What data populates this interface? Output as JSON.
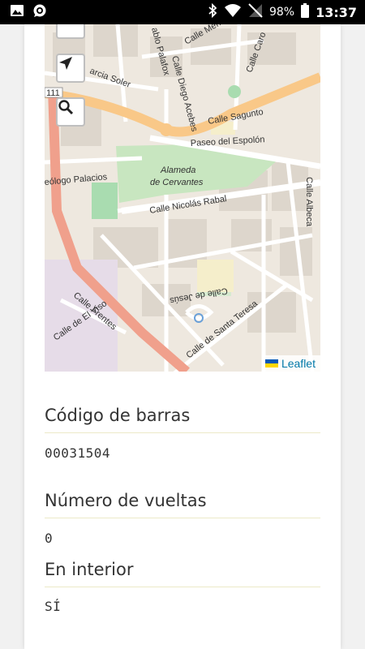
{
  "status_bar": {
    "battery_percent": "98%",
    "time": "13:37",
    "icons": [
      "image-icon",
      "whatsapp-icon",
      "bluetooth-icon",
      "wifi-icon",
      "no-signal-icon",
      "battery-icon"
    ]
  },
  "map": {
    "attribution": "Leaflet",
    "route_number": "111",
    "labels": {
      "calle_sagunto": "Calle Sagunto",
      "paseo_espolon": "Paseo del Espolón",
      "alameda": "Alameda",
      "cervantes": "de Cervantes",
      "calle_nicolas_rabal": "Calle Nicolás Rabal",
      "calle_albeca": "Calle Albeca",
      "geologo_palacios": "eólogo Palacios",
      "garcia_soler": "arcia Soler",
      "calle_diego_acebes": "Calle Diego Acebes",
      "pablo_palafox": "ablo Palafox",
      "calle_merino": "Calle Meri",
      "calle_caro": "Calle Caro",
      "calle_frentes": "Calle Frentes",
      "calle_el_viso": "Calle de El Viso",
      "calle_santa_teresa": "Calle de Santa Teresa",
      "calle_jesus": "Calle de Jesús"
    },
    "colors": {
      "background": "#eee8df",
      "park": "#c8e6c0",
      "major_road": "#f9c888",
      "primary_road": "#f0a08c",
      "minor_road": "#ffffff",
      "leaflet_link": "#0078a8"
    }
  },
  "fields": [
    {
      "label": "Código de barras",
      "value": "00031504"
    },
    {
      "label": "Número de vueltas",
      "value": "0"
    },
    {
      "label": "En interior",
      "value": "SÍ"
    }
  ]
}
